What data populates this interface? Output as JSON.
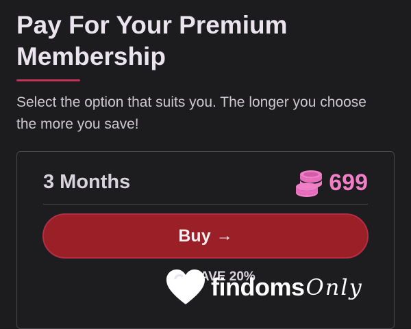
{
  "header": {
    "title": "Pay For Your Premium Membership",
    "subtitle": "Select the option that suits you. The longer you choose the more you save!"
  },
  "plan": {
    "duration_label": "3 Months",
    "price_icon": "coins-stack-icon",
    "price": "699",
    "buy_label": "Buy",
    "buy_icon": "arrow-right-icon",
    "savings_label": "SAVE 20%"
  },
  "watermark": {
    "brand_main": "findoms",
    "brand_script": "Only"
  },
  "colors": {
    "background": "#1c1b1d",
    "accent_pink": "#f07fc8",
    "button_red": "#9a1f27",
    "title_underline": "#c2335a"
  }
}
